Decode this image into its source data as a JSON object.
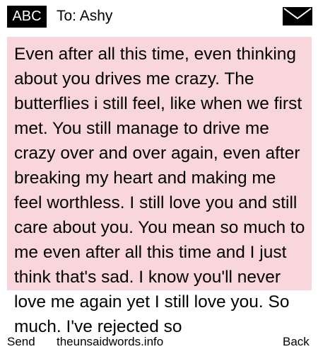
{
  "header": {
    "input_mode": "ABC",
    "recipient": "To: Ashy"
  },
  "message": {
    "text": "Even after all this time, even thinking about you drives me crazy. The butterflies i still feel, like when we first met. You still manage to drive me crazy over and over again, even after breaking my heart and making me feel worthless. I still love you and still care about you. You mean so much to me even after all this time and I just think that's sad. I know you'll never love me again yet I still love you. So much. I've rejected so"
  },
  "footer": {
    "send_label": "Send",
    "site_label": "theunsaidwords.info",
    "back_label": "Back"
  },
  "colors": {
    "message_background": "#f9d6dc",
    "badge_background": "#000000"
  },
  "icons": {
    "compose": "envelope-icon"
  }
}
